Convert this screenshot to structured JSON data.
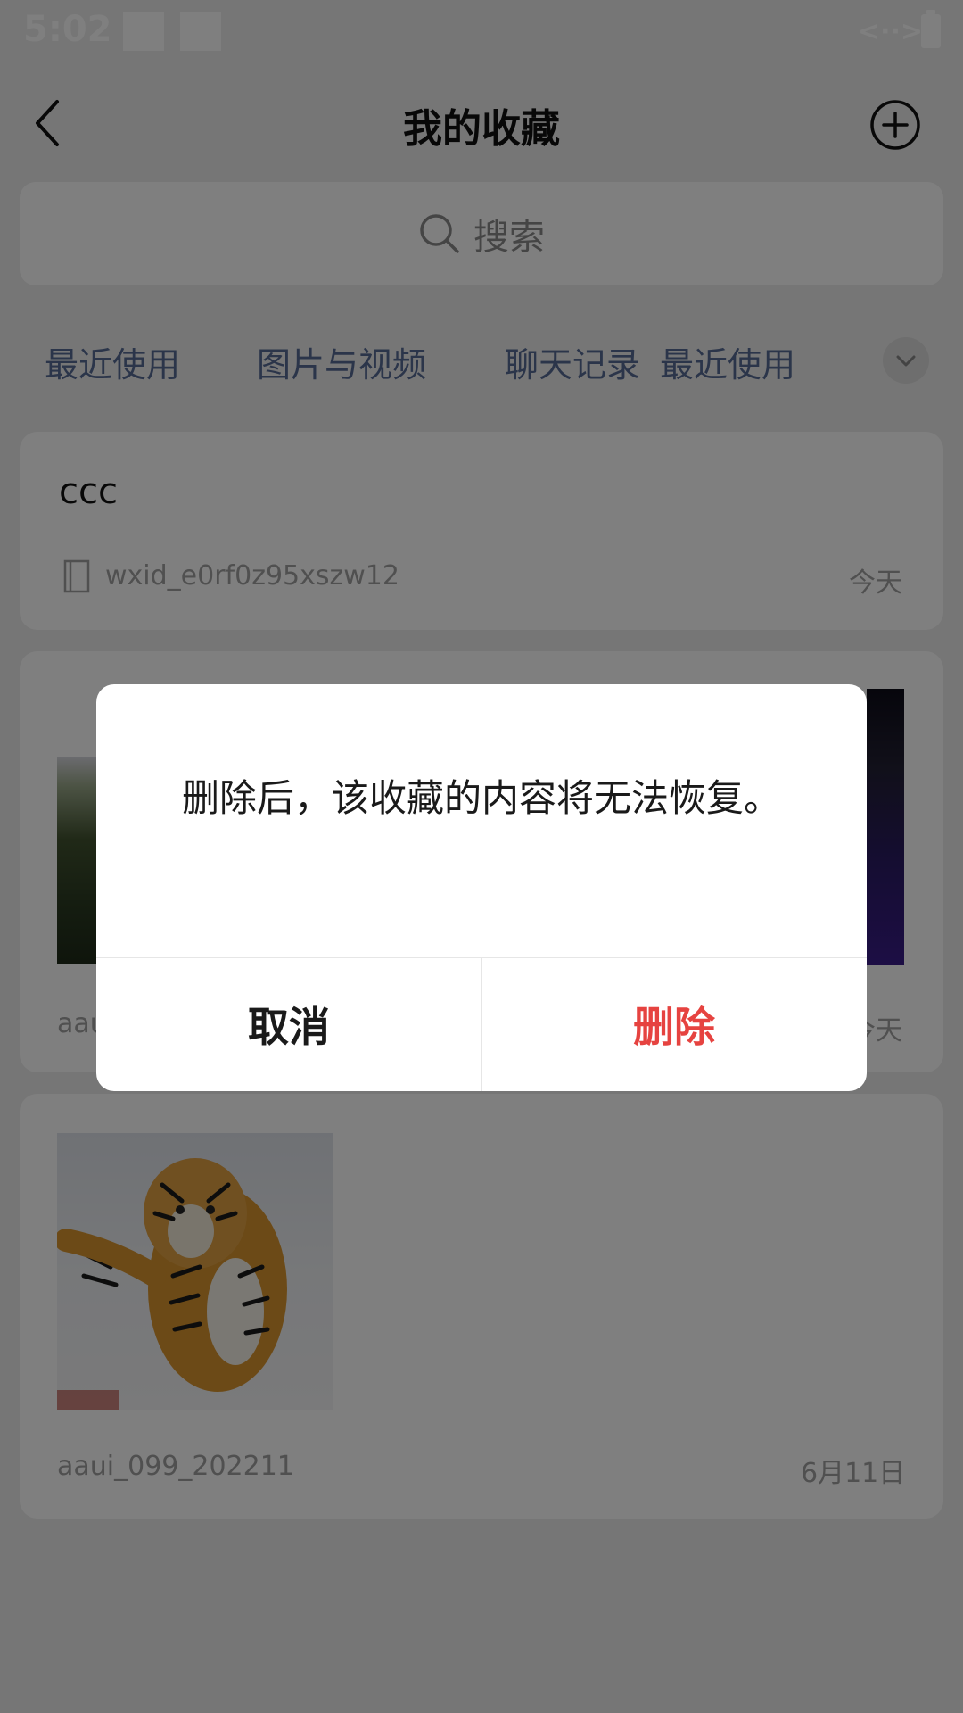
{
  "status_bar": {
    "time": "5:02",
    "link_icon": "<··>"
  },
  "header": {
    "title": "我的收藏",
    "back_icon": "chevron-left-icon",
    "add_icon": "plus-circle-icon"
  },
  "search": {
    "placeholder": "搜索",
    "icon": "search-icon"
  },
  "tabs": [
    {
      "label": "最近使用"
    },
    {
      "label": "图片与视频"
    },
    {
      "label": "聊天记录"
    },
    {
      "label": "最近使用"
    }
  ],
  "tabs_more_icon": "chevron-down-icon",
  "items": [
    {
      "title": "ccc",
      "source": "wxid_e0rf0z95xszw12",
      "date": "今天"
    },
    {
      "source": "aaui",
      "date": "今天"
    },
    {
      "source": "aaui_099_202211",
      "date": "6月11日"
    }
  ],
  "dialog": {
    "message": "删除后，该收藏的内容将无法恢复。",
    "cancel": "取消",
    "delete": "删除",
    "delete_color": "#e64340"
  }
}
